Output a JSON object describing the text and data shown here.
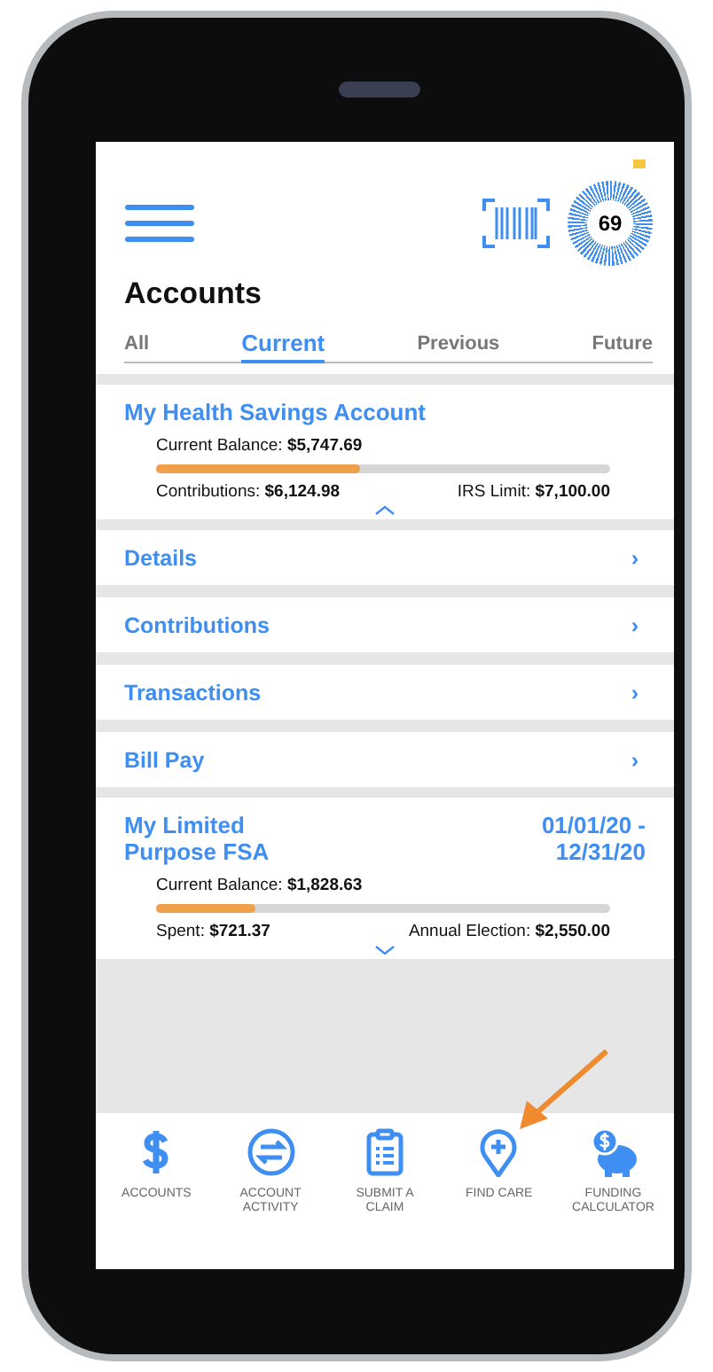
{
  "header": {
    "score": "69",
    "title": "Accounts"
  },
  "tabs": [
    {
      "label": "All",
      "selected": false
    },
    {
      "label": "Current",
      "selected": true
    },
    {
      "label": "Previous",
      "selected": false
    },
    {
      "label": "Future",
      "selected": false
    }
  ],
  "accounts": [
    {
      "name": "My Health Savings Account",
      "balance": "Current Balance: **$5,747.69**",
      "level": 0.45,
      "left": "Contributions: **$6,124.98**",
      "right": "IRS Limit: **$7,100.00**",
      "expanded": true,
      "links": [
        {
          "label": "Details",
          "chevron": "›"
        },
        {
          "label": "Contributions",
          "chevron": "›"
        },
        {
          "label": "Transactions",
          "chevron": "›"
        },
        {
          "label": "Bill Pay",
          "chevron": "›"
        }
      ]
    },
    {
      "name": "My Limited Purpose FSA",
      "dates": "01/01/20 - 12/31/20",
      "balance": "Current Balance: **$1,828.63**",
      "level": 0.22,
      "left": "Spent: **$721.37**",
      "right": "Annual Election: **$2,550.00**",
      "expanded": false
    }
  ],
  "nav": [
    {
      "kind": "dollar",
      "label": "ACCOUNTS"
    },
    {
      "kind": "activity",
      "label": "ACCOUNT ACTIVITY"
    },
    {
      "kind": "claim",
      "label": "SUBMIT A CLAIM"
    },
    {
      "kind": "care",
      "label": "FIND CARE"
    },
    {
      "kind": "calculator",
      "label": "FUNDING CALCULATOR"
    }
  ]
}
